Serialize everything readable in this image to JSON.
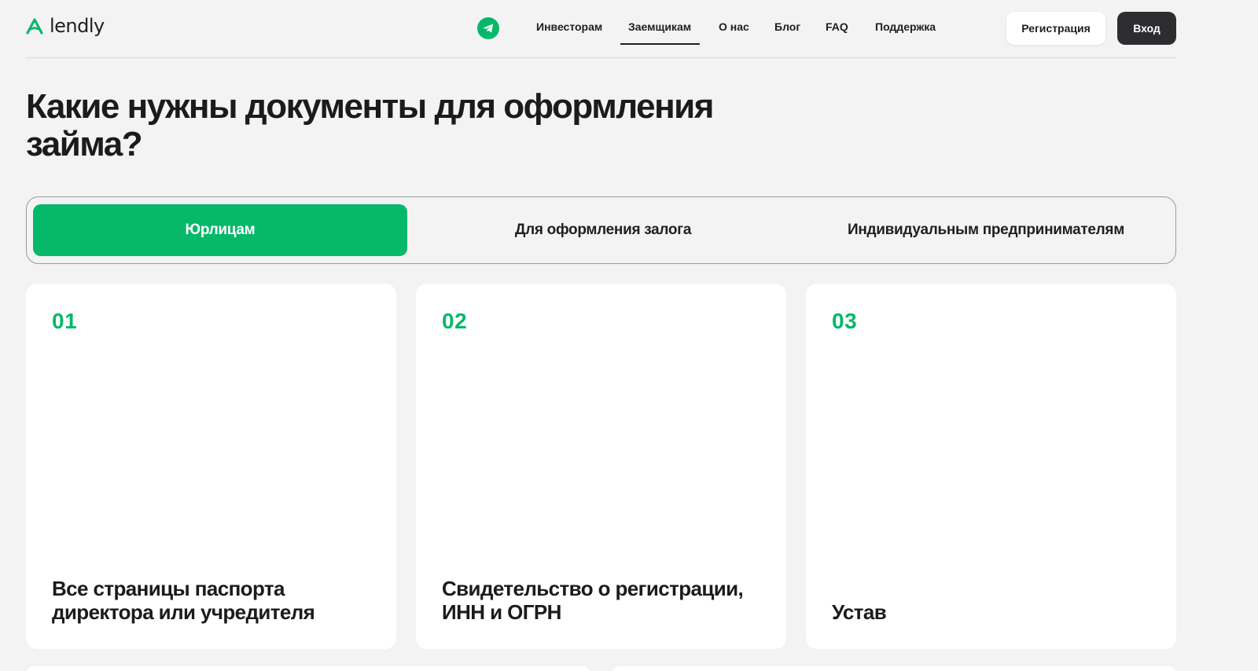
{
  "header": {
    "logo_text": "lendly",
    "nav": [
      {
        "label": "Инвесторам"
      },
      {
        "label": "Заемщикам",
        "active": true
      },
      {
        "label": "О нас"
      },
      {
        "label": "Блог"
      },
      {
        "label": "FAQ"
      },
      {
        "label": "Поддержка"
      }
    ],
    "register_label": "Регистрация",
    "login_label": "Вход"
  },
  "main": {
    "title": "Какие нужны документы для оформления займа?",
    "tabs": [
      {
        "label": "Юрлицам",
        "active": true
      },
      {
        "label": "Для оформления залога"
      },
      {
        "label": "Индивидуальным предпринимателям"
      }
    ],
    "cards": [
      {
        "number": "01",
        "text": "Все страницы паспорта директора или учредителя"
      },
      {
        "number": "02",
        "text": "Свидетельство о регистрации, ИНН и ОГРН"
      },
      {
        "number": "03",
        "text": "Устав"
      }
    ]
  },
  "colors": {
    "accent": "#06b86a",
    "background": "#f3f3f3",
    "dark_button": "#2d2d30",
    "card": "#ffffff"
  },
  "icons": {
    "logo": "lendly-logo-mark",
    "social": "telegram-icon"
  }
}
